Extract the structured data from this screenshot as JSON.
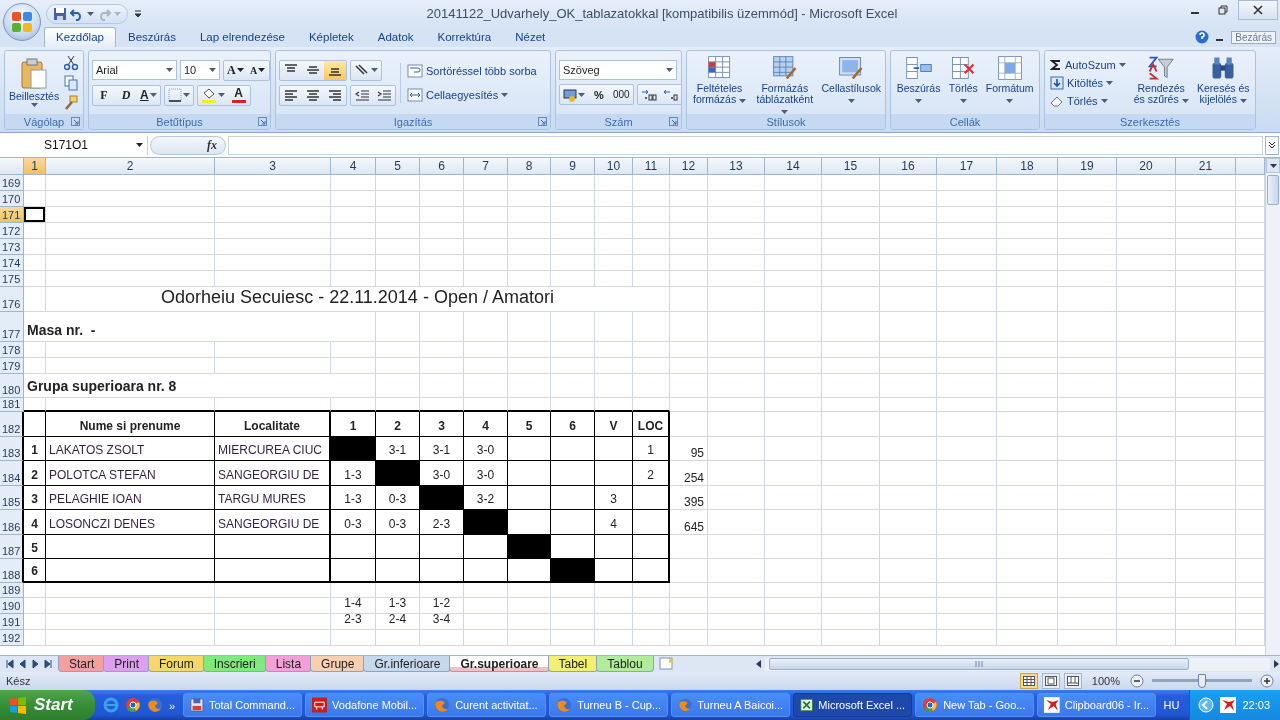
{
  "window": {
    "title": "20141122_Udvarhely_OK_tablazatokkal  [kompatibilis üzemmód] - Microsoft Excel",
    "tooltip": "Bezárás"
  },
  "ribbon_tabs": [
    {
      "label": "Kezdőlap",
      "selected": true
    },
    {
      "label": "Beszúrás",
      "selected": false
    },
    {
      "label": "Lap elrendezése",
      "selected": false
    },
    {
      "label": "Képletek",
      "selected": false
    },
    {
      "label": "Adatok",
      "selected": false
    },
    {
      "label": "Korrektúra",
      "selected": false
    },
    {
      "label": "Nézet",
      "selected": false
    }
  ],
  "ribbon": {
    "clipboard": {
      "title": "Vágólap",
      "paste": "Beillesztés"
    },
    "font": {
      "title": "Betűtípus",
      "font": "Arial",
      "size": "10",
      "grow": "A",
      "shrink": "A",
      "bold": "F",
      "italic": "D",
      "underline": "A",
      "color_letter": "A"
    },
    "alignment": {
      "title": "Igazítás",
      "valign": [
        {
          "selected": false
        },
        {
          "selected": false
        },
        {
          "selected": true
        }
      ],
      "wrap": "Sortöréssel több sorba",
      "merge": "Cellaegyesítés"
    },
    "number": {
      "title": "Szám",
      "format": "Szöveg",
      "percent": "%",
      "thousands": "000"
    },
    "styles": {
      "title": "Stílusok",
      "buttons": [
        {
          "label": "Feltételes formázás",
          "kind": "conditional"
        },
        {
          "label": "Formázás táblázatként",
          "kind": "table"
        },
        {
          "label": "Cellastílusok",
          "kind": "cellstyle"
        }
      ]
    },
    "cells": {
      "title": "Cellák",
      "buttons": [
        {
          "label": "Beszúrás",
          "kind": "insert"
        },
        {
          "label": "Törlés",
          "kind": "delete"
        },
        {
          "label": "Formátum",
          "kind": "format"
        }
      ]
    },
    "editing": {
      "title": "Szerkesztés",
      "small": [
        {
          "label": "AutoSzum",
          "kind": "sum"
        },
        {
          "label": "Kitöltés",
          "kind": "fill"
        },
        {
          "label": "Törlés",
          "kind": "clear"
        }
      ],
      "buttons": [
        {
          "label": "Rendezés és szűrés",
          "kind": "sort"
        },
        {
          "label": "Keresés és kijelölés",
          "kind": "find"
        }
      ]
    }
  },
  "formula_bar": {
    "name_box": "S171O1",
    "fx": "fx"
  },
  "sheet": {
    "column_headers": [
      {
        "label": "1",
        "selected": true
      },
      {
        "label": "2",
        "selected": false
      },
      {
        "label": "3",
        "selected": false
      },
      {
        "label": "4",
        "selected": false
      },
      {
        "label": "5",
        "selected": false
      },
      {
        "label": "6",
        "selected": false
      },
      {
        "label": "7",
        "selected": false
      },
      {
        "label": "8",
        "selected": false
      },
      {
        "label": "9",
        "selected": false
      },
      {
        "label": "10",
        "selected": false
      },
      {
        "label": "11",
        "selected": false
      },
      {
        "label": "12",
        "selected": false
      },
      {
        "label": "13",
        "selected": false
      },
      {
        "label": "14",
        "selected": false
      },
      {
        "label": "15",
        "selected": false
      },
      {
        "label": "16",
        "selected": false
      },
      {
        "label": "17",
        "selected": false
      },
      {
        "label": "18",
        "selected": false
      },
      {
        "label": "19",
        "selected": false
      },
      {
        "label": "20",
        "selected": false
      },
      {
        "label": "21",
        "selected": false
      }
    ],
    "rows": [
      {
        "number": "169",
        "selected": false
      },
      {
        "number": "170",
        "selected": false
      },
      {
        "number": "171",
        "selected": true,
        "cells": [
          {
            "kind": "active",
            "selected": true
          }
        ]
      },
      {
        "number": "172",
        "selected": false
      },
      {
        "number": "173",
        "selected": false
      },
      {
        "number": "174",
        "selected": false
      },
      {
        "number": "175",
        "selected": false
      },
      {
        "number": "176",
        "selected": false,
        "cells": [
          null,
          {
            "kind": "title",
            "text": "Odorheiu Secuiesc - 22.11.2014 - Open / Amatori"
          }
        ]
      },
      {
        "number": "177",
        "selected": false,
        "cells": [
          {
            "kind": "label",
            "text": "Masa nr.  -"
          }
        ]
      },
      {
        "number": "178",
        "selected": false
      },
      {
        "number": "179",
        "selected": false
      },
      {
        "number": "180",
        "selected": false,
        "cells": [
          {
            "kind": "label",
            "text": "Grupa superioara nr. 8"
          }
        ]
      },
      {
        "number": "181",
        "selected": false
      },
      {
        "number": "182",
        "selected": false,
        "kind": "table",
        "cells": [
          null,
          {
            "kind": "header",
            "text": "Nume si prenume"
          },
          {
            "kind": "header",
            "text": "Localitate"
          },
          {
            "kind": "header",
            "text": "1"
          },
          {
            "kind": "header",
            "text": "2"
          },
          {
            "kind": "header",
            "text": "3"
          },
          {
            "kind": "header",
            "text": "4"
          },
          {
            "kind": "header",
            "text": "5"
          },
          {
            "kind": "header",
            "text": "6"
          },
          {
            "kind": "header",
            "text": "V"
          },
          {
            "kind": "header",
            "text": "LOC"
          }
        ]
      },
      {
        "number": "183",
        "selected": false,
        "kind": "table",
        "cells": [
          {
            "kind": "index",
            "text": "1"
          },
          {
            "kind": "name",
            "text": "LAKATOS ZSOLT"
          },
          {
            "kind": "name",
            "text": "MIERCUREA CIUC"
          },
          {
            "kind": "filled"
          },
          {
            "kind": "score",
            "text": "3-1"
          },
          {
            "kind": "score",
            "text": "3-1"
          },
          {
            "kind": "score",
            "text": "3-0"
          },
          null,
          null,
          null,
          {
            "kind": "score",
            "text": "1"
          },
          {
            "kind": "side",
            "text": "95"
          }
        ]
      },
      {
        "number": "184",
        "selected": false,
        "kind": "table",
        "cells": [
          {
            "kind": "index",
            "text": "2"
          },
          {
            "kind": "name",
            "text": "POLOTCA STEFAN"
          },
          {
            "kind": "name",
            "text": "SANGEORGIU DE"
          },
          {
            "kind": "score",
            "text": "1-3"
          },
          {
            "kind": "filled"
          },
          {
            "kind": "score",
            "text": "3-0"
          },
          {
            "kind": "score",
            "text": "3-0"
          },
          null,
          null,
          null,
          {
            "kind": "score",
            "text": "2"
          },
          {
            "kind": "side",
            "text": "254"
          }
        ]
      },
      {
        "number": "185",
        "selected": false,
        "kind": "table",
        "cells": [
          {
            "kind": "index",
            "text": "3"
          },
          {
            "kind": "name",
            "text": "PELAGHIE IOAN"
          },
          {
            "kind": "name",
            "text": "TARGU MURES"
          },
          {
            "kind": "score",
            "text": "1-3"
          },
          {
            "kind": "score",
            "text": "0-3"
          },
          {
            "kind": "filled"
          },
          {
            "kind": "score",
            "text": "3-2"
          },
          null,
          null,
          {
            "kind": "score",
            "text": "3"
          },
          null,
          {
            "kind": "side",
            "text": "395"
          }
        ]
      },
      {
        "number": "186",
        "selected": false,
        "kind": "table",
        "cells": [
          {
            "kind": "index",
            "text": "4"
          },
          {
            "kind": "name",
            "text": "LOSONCZI DENES"
          },
          {
            "kind": "name",
            "text": "SANGEORGIU DE"
          },
          {
            "kind": "score",
            "text": "0-3"
          },
          {
            "kind": "score",
            "text": "0-3"
          },
          {
            "kind": "score",
            "text": "2-3"
          },
          {
            "kind": "filled"
          },
          null,
          null,
          {
            "kind": "score",
            "text": "4"
          },
          null,
          {
            "kind": "side",
            "text": "645"
          }
        ]
      },
      {
        "number": "187",
        "selected": false,
        "kind": "table",
        "cells": [
          {
            "kind": "index",
            "text": "5"
          },
          null,
          null,
          null,
          null,
          null,
          null,
          {
            "kind": "filled"
          }
        ]
      },
      {
        "number": "188",
        "selected": false,
        "kind": "table",
        "cells": [
          {
            "kind": "index",
            "text": "6"
          },
          null,
          null,
          null,
          null,
          null,
          null,
          null,
          {
            "kind": "filled"
          }
        ]
      },
      {
        "number": "189",
        "selected": false
      },
      {
        "number": "190",
        "selected": false,
        "cells": [
          null,
          null,
          null,
          {
            "kind": "score",
            "text": "1-4"
          },
          {
            "kind": "score",
            "text": "1-3"
          },
          {
            "kind": "score",
            "text": "1-2"
          }
        ]
      },
      {
        "number": "191",
        "selected": false,
        "cells": [
          null,
          null,
          null,
          {
            "kind": "score",
            "text": "2-3"
          },
          {
            "kind": "score",
            "text": "2-4"
          },
          {
            "kind": "score",
            "text": "3-4"
          }
        ]
      },
      {
        "number": "192",
        "selected": false
      }
    ]
  },
  "sheet_tabs": [
    {
      "label": "Start",
      "color": "#f4a0a0",
      "selected": false
    },
    {
      "label": "Print",
      "color": "#dca0ee",
      "selected": false
    },
    {
      "label": "Forum",
      "color": "#f6d86a",
      "selected": false
    },
    {
      "label": "Inscrieri",
      "color": "#7eea7e",
      "selected": false
    },
    {
      "label": "Lista",
      "color": "#f4a0d8",
      "selected": false
    },
    {
      "label": "Grupe",
      "color": "#f8d0b0",
      "selected": false
    },
    {
      "label": "Gr.inferioare",
      "color": "#c6d8ee",
      "selected": false
    },
    {
      "label": "Gr.superioare",
      "color": "#f4c0c0",
      "selected": true
    },
    {
      "label": "Tabel",
      "color": "#f2f070",
      "selected": false
    },
    {
      "label": "Tablou",
      "color": "#b0ec9c",
      "selected": false
    }
  ],
  "status_bar": {
    "text": "Kész",
    "views": [
      {
        "selected": true
      },
      {
        "selected": false
      },
      {
        "selected": false
      }
    ],
    "zoom": "100%",
    "zoom_slider": {
      "level": 0.5
    }
  },
  "taskbar": {
    "start": "Start",
    "more": "»",
    "items": [
      {
        "label": "Total Command...",
        "kind": "disk",
        "selected": false
      },
      {
        "label": "Vodafone Mobil...",
        "kind": "modem",
        "selected": false
      },
      {
        "label": "Curent activitat...",
        "kind": "fox",
        "selected": false
      },
      {
        "label": "Turneu B - Cup...",
        "kind": "fox",
        "selected": false
      },
      {
        "label": "Turneu A Baicoi...",
        "kind": "fox",
        "selected": false
      },
      {
        "label": "Microsoft Excel ...",
        "kind": "sheet",
        "selected": true
      },
      {
        "label": "New Tab - Goo...",
        "kind": "ring",
        "selected": false
      },
      {
        "label": "Clipboard06 - Ir...",
        "kind": "paint",
        "selected": false
      }
    ],
    "language": "HU",
    "clock": "22:03"
  }
}
